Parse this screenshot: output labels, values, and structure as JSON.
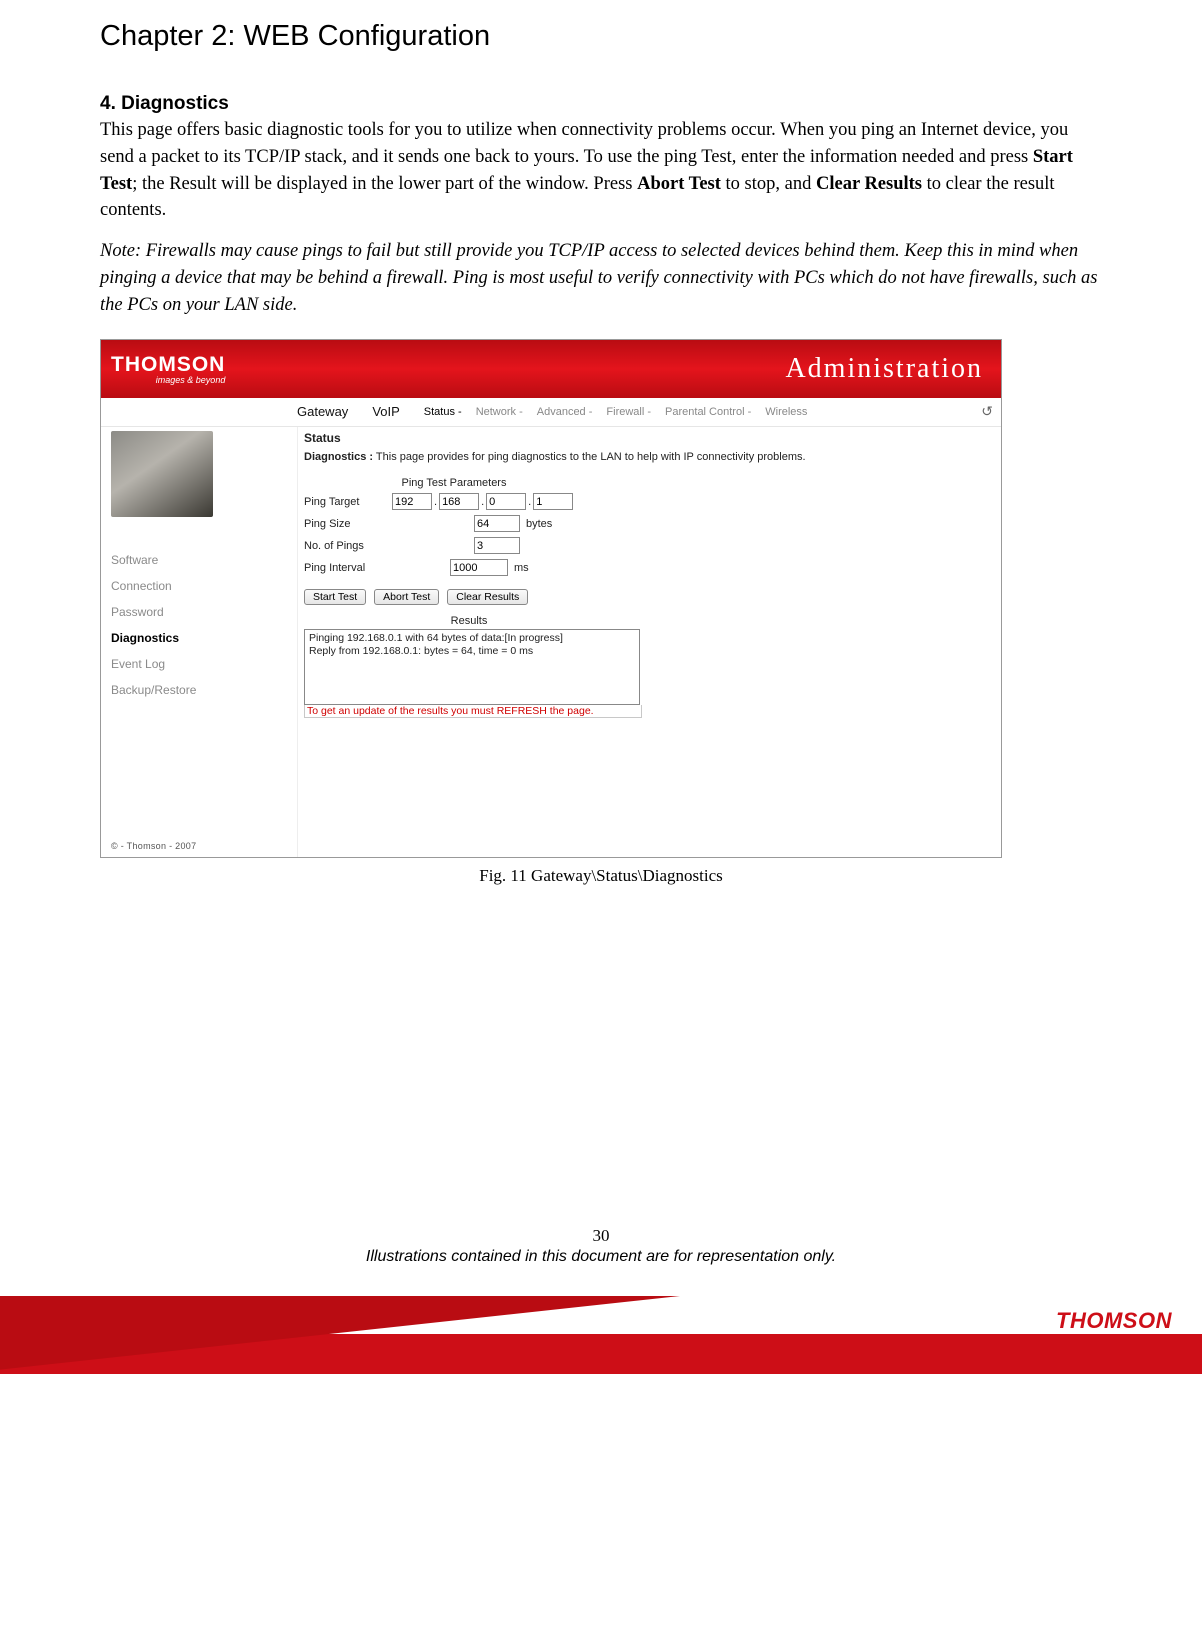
{
  "chapter": "Chapter 2: WEB Configuration",
  "section": "4. Diagnostics",
  "para1_a": "This page offers basic diagnostic tools for you to utilize when connectivity problems occur. When you ping an Internet device, you send a packet to its TCP/IP stack, and it sends one back to yours. To use the ping Test, enter the information needed and press ",
  "para1_b": "Start Test",
  "para1_c": "; the Result will be displayed in the lower part of the window. Press ",
  "para1_d": "Abort Test",
  "para1_e": " to stop, and ",
  "para1_f": "Clear Results",
  "para1_g": " to clear the result contents.",
  "note": "Note: Firewalls may cause pings to fail but still provide you TCP/IP access to selected devices behind them. Keep this in mind when pinging a device that may be behind a firewall. Ping is most useful to verify connectivity with PCs which do not have firewalls, such as the PCs on your LAN side.",
  "shot": {
    "logo_main": "THOMSON",
    "logo_sub": "images & beyond",
    "banner_title": "Administration",
    "maintabs": [
      "Gateway",
      "VoIP"
    ],
    "subtabs": [
      "Status -",
      "Network -",
      "Advanced -",
      "Firewall -",
      "Parental Control -",
      "Wireless"
    ],
    "sidebar": [
      "Software",
      "Connection",
      "Password",
      "Diagnostics",
      "Event Log",
      "Backup/Restore"
    ],
    "sidebar_active_index": 3,
    "copyright": "© - Thomson - 2007",
    "content": {
      "h": "Status",
      "desc_b": "Diagnostics  :",
      "desc_r": "  This page provides for ping diagnostics to the LAN to help with IP connectivity problems.",
      "params_title": "Ping Test Parameters",
      "rows": {
        "target_label": "Ping Target",
        "target_ip": [
          "192",
          "168",
          "0",
          "1"
        ],
        "size_label": "Ping Size",
        "size_val": "64",
        "size_unit": "bytes",
        "count_label": "No. of Pings",
        "count_val": "3",
        "interval_label": "Ping Interval",
        "interval_val": "1000",
        "interval_unit": "ms"
      },
      "buttons": [
        "Start Test",
        "Abort Test",
        "Clear Results"
      ],
      "results_title": "Results",
      "results_lines": [
        "Pinging 192.168.0.1 with 64 bytes of data:[In progress]",
        "Reply from 192.168.0.1: bytes = 64, time = 0 ms"
      ],
      "refresh_note": "To get an update of the results you must REFRESH the page."
    }
  },
  "fig_caption": "Fig. 11 Gateway\\Status\\Diagnostics",
  "page_number": "30",
  "rep_note": "Illustrations contained in this document are for representation only.",
  "footer_logo": "THOMSON"
}
